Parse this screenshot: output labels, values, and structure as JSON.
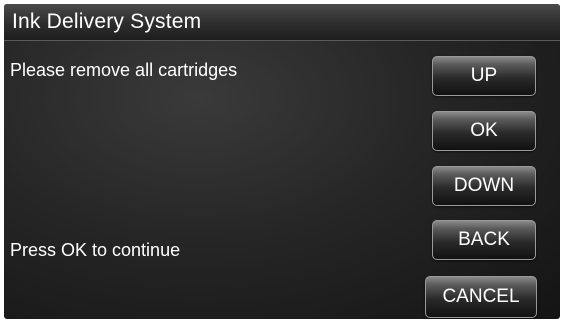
{
  "window": {
    "title": "Ink Delivery System"
  },
  "messages": {
    "instruction": "Please remove all cartridges",
    "prompt": "Press OK to continue"
  },
  "buttons": {
    "up": "UP",
    "ok": "OK",
    "down": "DOWN",
    "back": "BACK",
    "cancel": "CANCEL"
  }
}
